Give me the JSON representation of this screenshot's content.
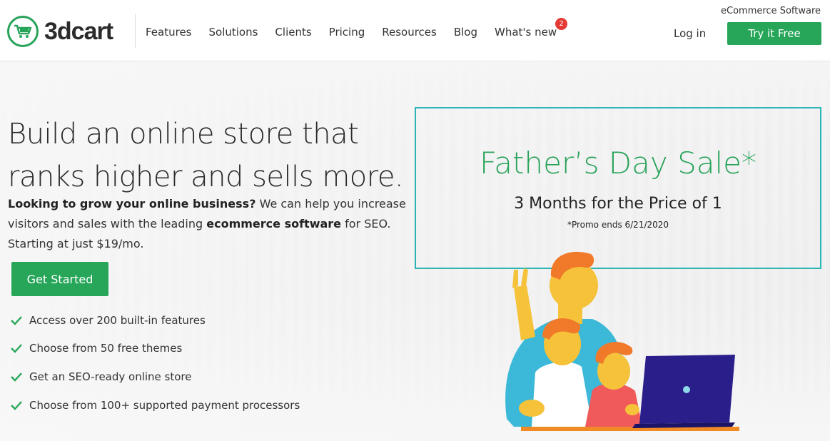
{
  "brand": {
    "logo_text": "3dcart",
    "tagline": "eCommerce Software"
  },
  "nav": {
    "items": [
      {
        "label": "Features"
      },
      {
        "label": "Solutions"
      },
      {
        "label": "Clients"
      },
      {
        "label": "Pricing"
      },
      {
        "label": "Resources"
      },
      {
        "label": "Blog"
      },
      {
        "label": "What's new",
        "badge": "2"
      }
    ],
    "login_label": "Log in",
    "cta_label": "Try it Free"
  },
  "hero": {
    "headline_line1": "Build an online store that",
    "headline_line2": "ranks higher and sells more.",
    "intro_bold1": "Looking to grow your online business?",
    "intro_text1": " We can help you increase visitors and sales with the leading ",
    "intro_bold2": "ecommerce software",
    "intro_text2": " for SEO. Starting at just $19/mo.",
    "cta_label": "Get Started",
    "features": [
      "Access over 200 built-in features",
      "Choose from 50 free themes",
      "Get an SEO-ready online store",
      "Choose from 100+ supported payment processors"
    ]
  },
  "promo": {
    "title": "Father’s Day Sale*",
    "subtitle": "3 Months for the Price of 1",
    "note": "*Promo ends 6/21/2020"
  },
  "colors": {
    "accent_green": "#27a65a",
    "promo_border": "#2bb5b5",
    "badge_red": "#e53935"
  },
  "icons": [
    "shopping-cart-icon",
    "check-icon"
  ]
}
